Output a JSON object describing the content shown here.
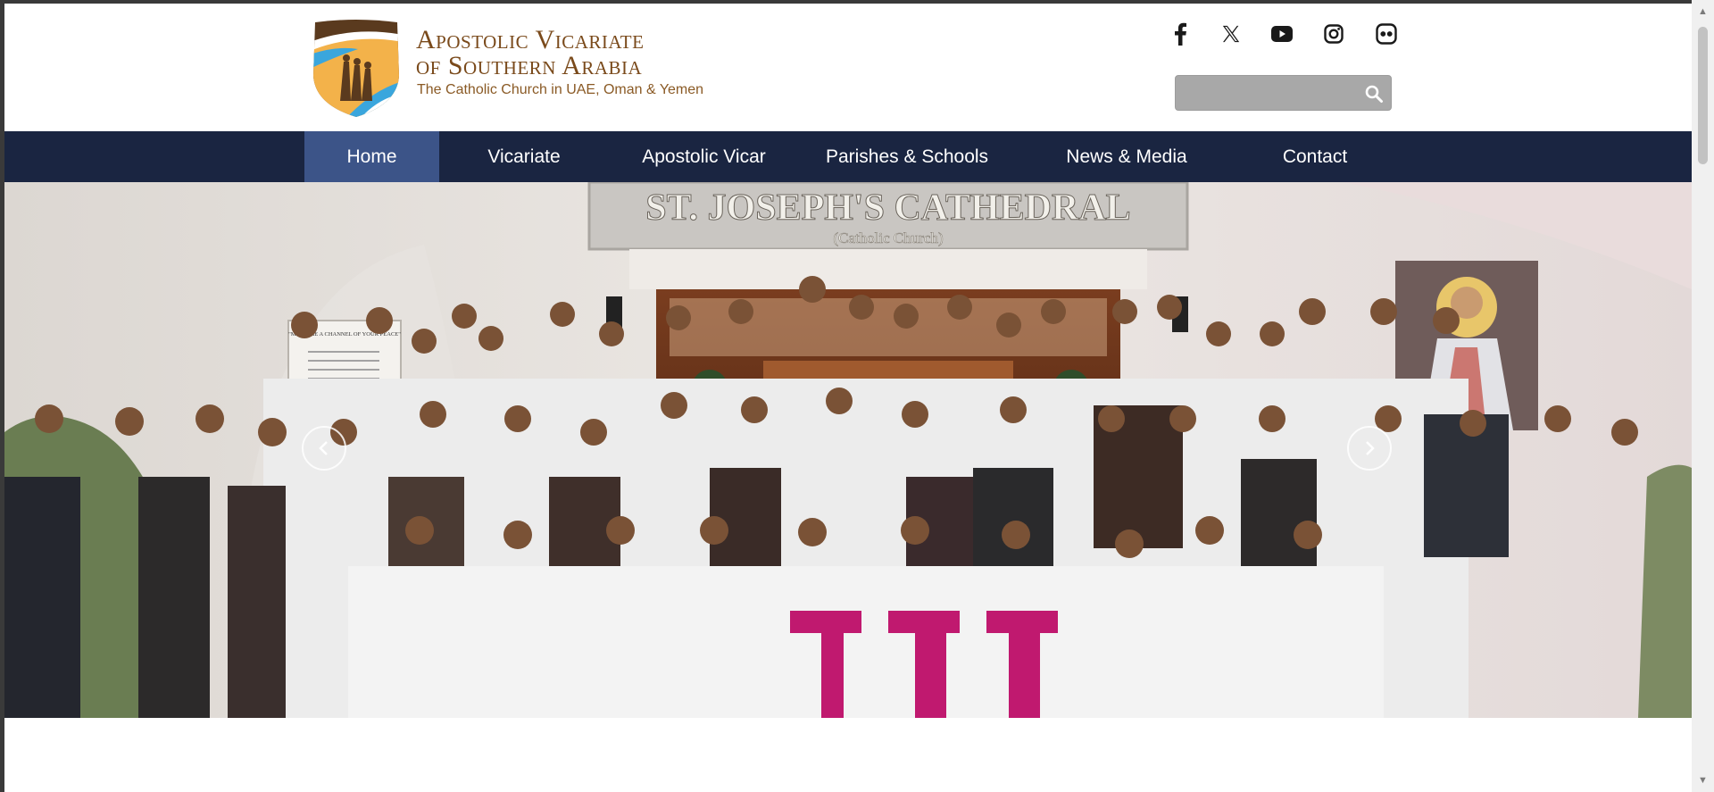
{
  "header": {
    "logo_title_line1": "Apostolic Vicariate",
    "logo_title_line2": "of Southern Arabia",
    "logo_subtitle": "The Catholic Church in UAE, Oman & Yemen",
    "social_icons": [
      "facebook-icon",
      "x-icon",
      "youtube-icon",
      "instagram-icon",
      "flickr-icon"
    ],
    "search": {
      "placeholder": "",
      "value": ""
    }
  },
  "nav": {
    "items": [
      {
        "label": "Home",
        "active": true
      },
      {
        "label": "Vicariate",
        "active": false
      },
      {
        "label": "Apostolic Vicar",
        "active": false
      },
      {
        "label": "Parishes & Schools",
        "active": false
      },
      {
        "label": "News & Media",
        "active": false
      },
      {
        "label": "Contact",
        "active": false
      }
    ]
  },
  "hero": {
    "building_sign": "ST. JOSEPH'S CATHEDRAL",
    "building_sign_sub": "(Catholic Church)",
    "notice_board": "\"MAKE ME A CHANNEL OF YOUR PEACE\"",
    "prev_icon": "chevron-left-icon",
    "next_icon": "chevron-right-icon"
  },
  "colors": {
    "nav_bg": "#1a2541",
    "nav_active": "#3c5488",
    "logo_brown": "#7a4a1b",
    "search_bg": "#a8a8a8"
  }
}
